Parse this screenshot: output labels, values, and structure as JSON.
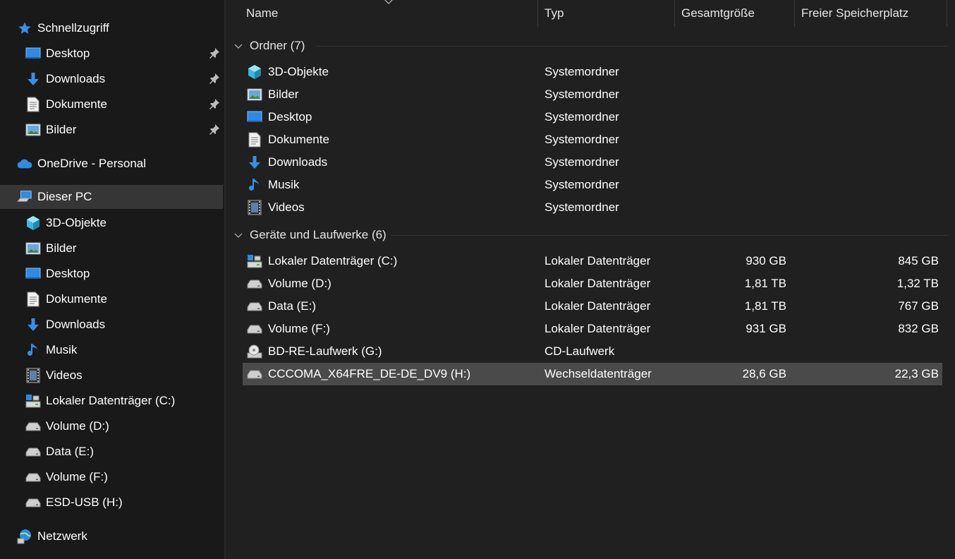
{
  "columns": {
    "name": "Name",
    "type": "Typ",
    "total": "Gesamtgröße",
    "free": "Freier Speicherplatz"
  },
  "sidebar": {
    "quick_access": {
      "label": "Schnellzugriff",
      "icon": "star-icon"
    },
    "quick_items": [
      {
        "label": "Desktop",
        "icon": "desktop-icon"
      },
      {
        "label": "Downloads",
        "icon": "download-icon"
      },
      {
        "label": "Dokumente",
        "icon": "document-icon"
      },
      {
        "label": "Bilder",
        "icon": "pictures-icon"
      }
    ],
    "onedrive": {
      "label": "OneDrive - Personal",
      "icon": "cloud-icon"
    },
    "this_pc": {
      "label": "Dieser PC",
      "icon": "computer-icon"
    },
    "pc_items": [
      {
        "label": "3D-Objekte",
        "icon": "cube-icon"
      },
      {
        "label": "Bilder",
        "icon": "pictures-icon"
      },
      {
        "label": "Desktop",
        "icon": "desktop-icon"
      },
      {
        "label": "Dokumente",
        "icon": "document-icon"
      },
      {
        "label": "Downloads",
        "icon": "download-icon"
      },
      {
        "label": "Musik",
        "icon": "music-icon"
      },
      {
        "label": "Videos",
        "icon": "video-icon"
      },
      {
        "label": "Lokaler Datenträger (C:)",
        "icon": "windows-drive-icon"
      },
      {
        "label": "Volume (D:)",
        "icon": "drive-icon"
      },
      {
        "label": "Data (E:)",
        "icon": "drive-icon"
      },
      {
        "label": "Volume (F:)",
        "icon": "drive-icon"
      },
      {
        "label": "ESD-USB (H:)",
        "icon": "drive-icon"
      }
    ],
    "network": {
      "label": "Netzwerk",
      "icon": "network-icon"
    }
  },
  "groups": {
    "folders": {
      "label": "Ordner (7)",
      "items": [
        {
          "name": "3D-Objekte",
          "type": "Systemordner",
          "icon": "cube-icon"
        },
        {
          "name": "Bilder",
          "type": "Systemordner",
          "icon": "pictures-icon"
        },
        {
          "name": "Desktop",
          "type": "Systemordner",
          "icon": "desktop-icon"
        },
        {
          "name": "Dokumente",
          "type": "Systemordner",
          "icon": "document-icon"
        },
        {
          "name": "Downloads",
          "type": "Systemordner",
          "icon": "download-icon"
        },
        {
          "name": "Musik",
          "type": "Systemordner",
          "icon": "music-icon"
        },
        {
          "name": "Videos",
          "type": "Systemordner",
          "icon": "video-icon"
        }
      ]
    },
    "drives": {
      "label": "Geräte und Laufwerke (6)",
      "items": [
        {
          "name": "Lokaler Datenträger (C:)",
          "type": "Lokaler Datenträger",
          "total": "930 GB",
          "free": "845 GB",
          "icon": "windows-drive-icon"
        },
        {
          "name": "Volume (D:)",
          "type": "Lokaler Datenträger",
          "total": "1,81 TB",
          "free": "1,32 TB",
          "icon": "drive-icon"
        },
        {
          "name": "Data (E:)",
          "type": "Lokaler Datenträger",
          "total": "1,81 TB",
          "free": "767 GB",
          "icon": "drive-icon"
        },
        {
          "name": "Volume (F:)",
          "type": "Lokaler Datenträger",
          "total": "931 GB",
          "free": "832 GB",
          "icon": "drive-icon"
        },
        {
          "name": "BD-RE-Laufwerk (G:)",
          "type": "CD-Laufwerk",
          "total": "",
          "free": "",
          "icon": "optical-drive-icon"
        },
        {
          "name": "CCCOMA_X64FRE_DE-DE_DV9 (H:)",
          "type": "Wechseldatenträger",
          "total": "28,6 GB",
          "free": "22,3 GB",
          "icon": "drive-icon"
        }
      ]
    }
  },
  "colors": {
    "background": "#202020",
    "sidebar": "#191919",
    "selected_row": "#4a4a4a",
    "accent_blue": "#2f8ae0"
  }
}
